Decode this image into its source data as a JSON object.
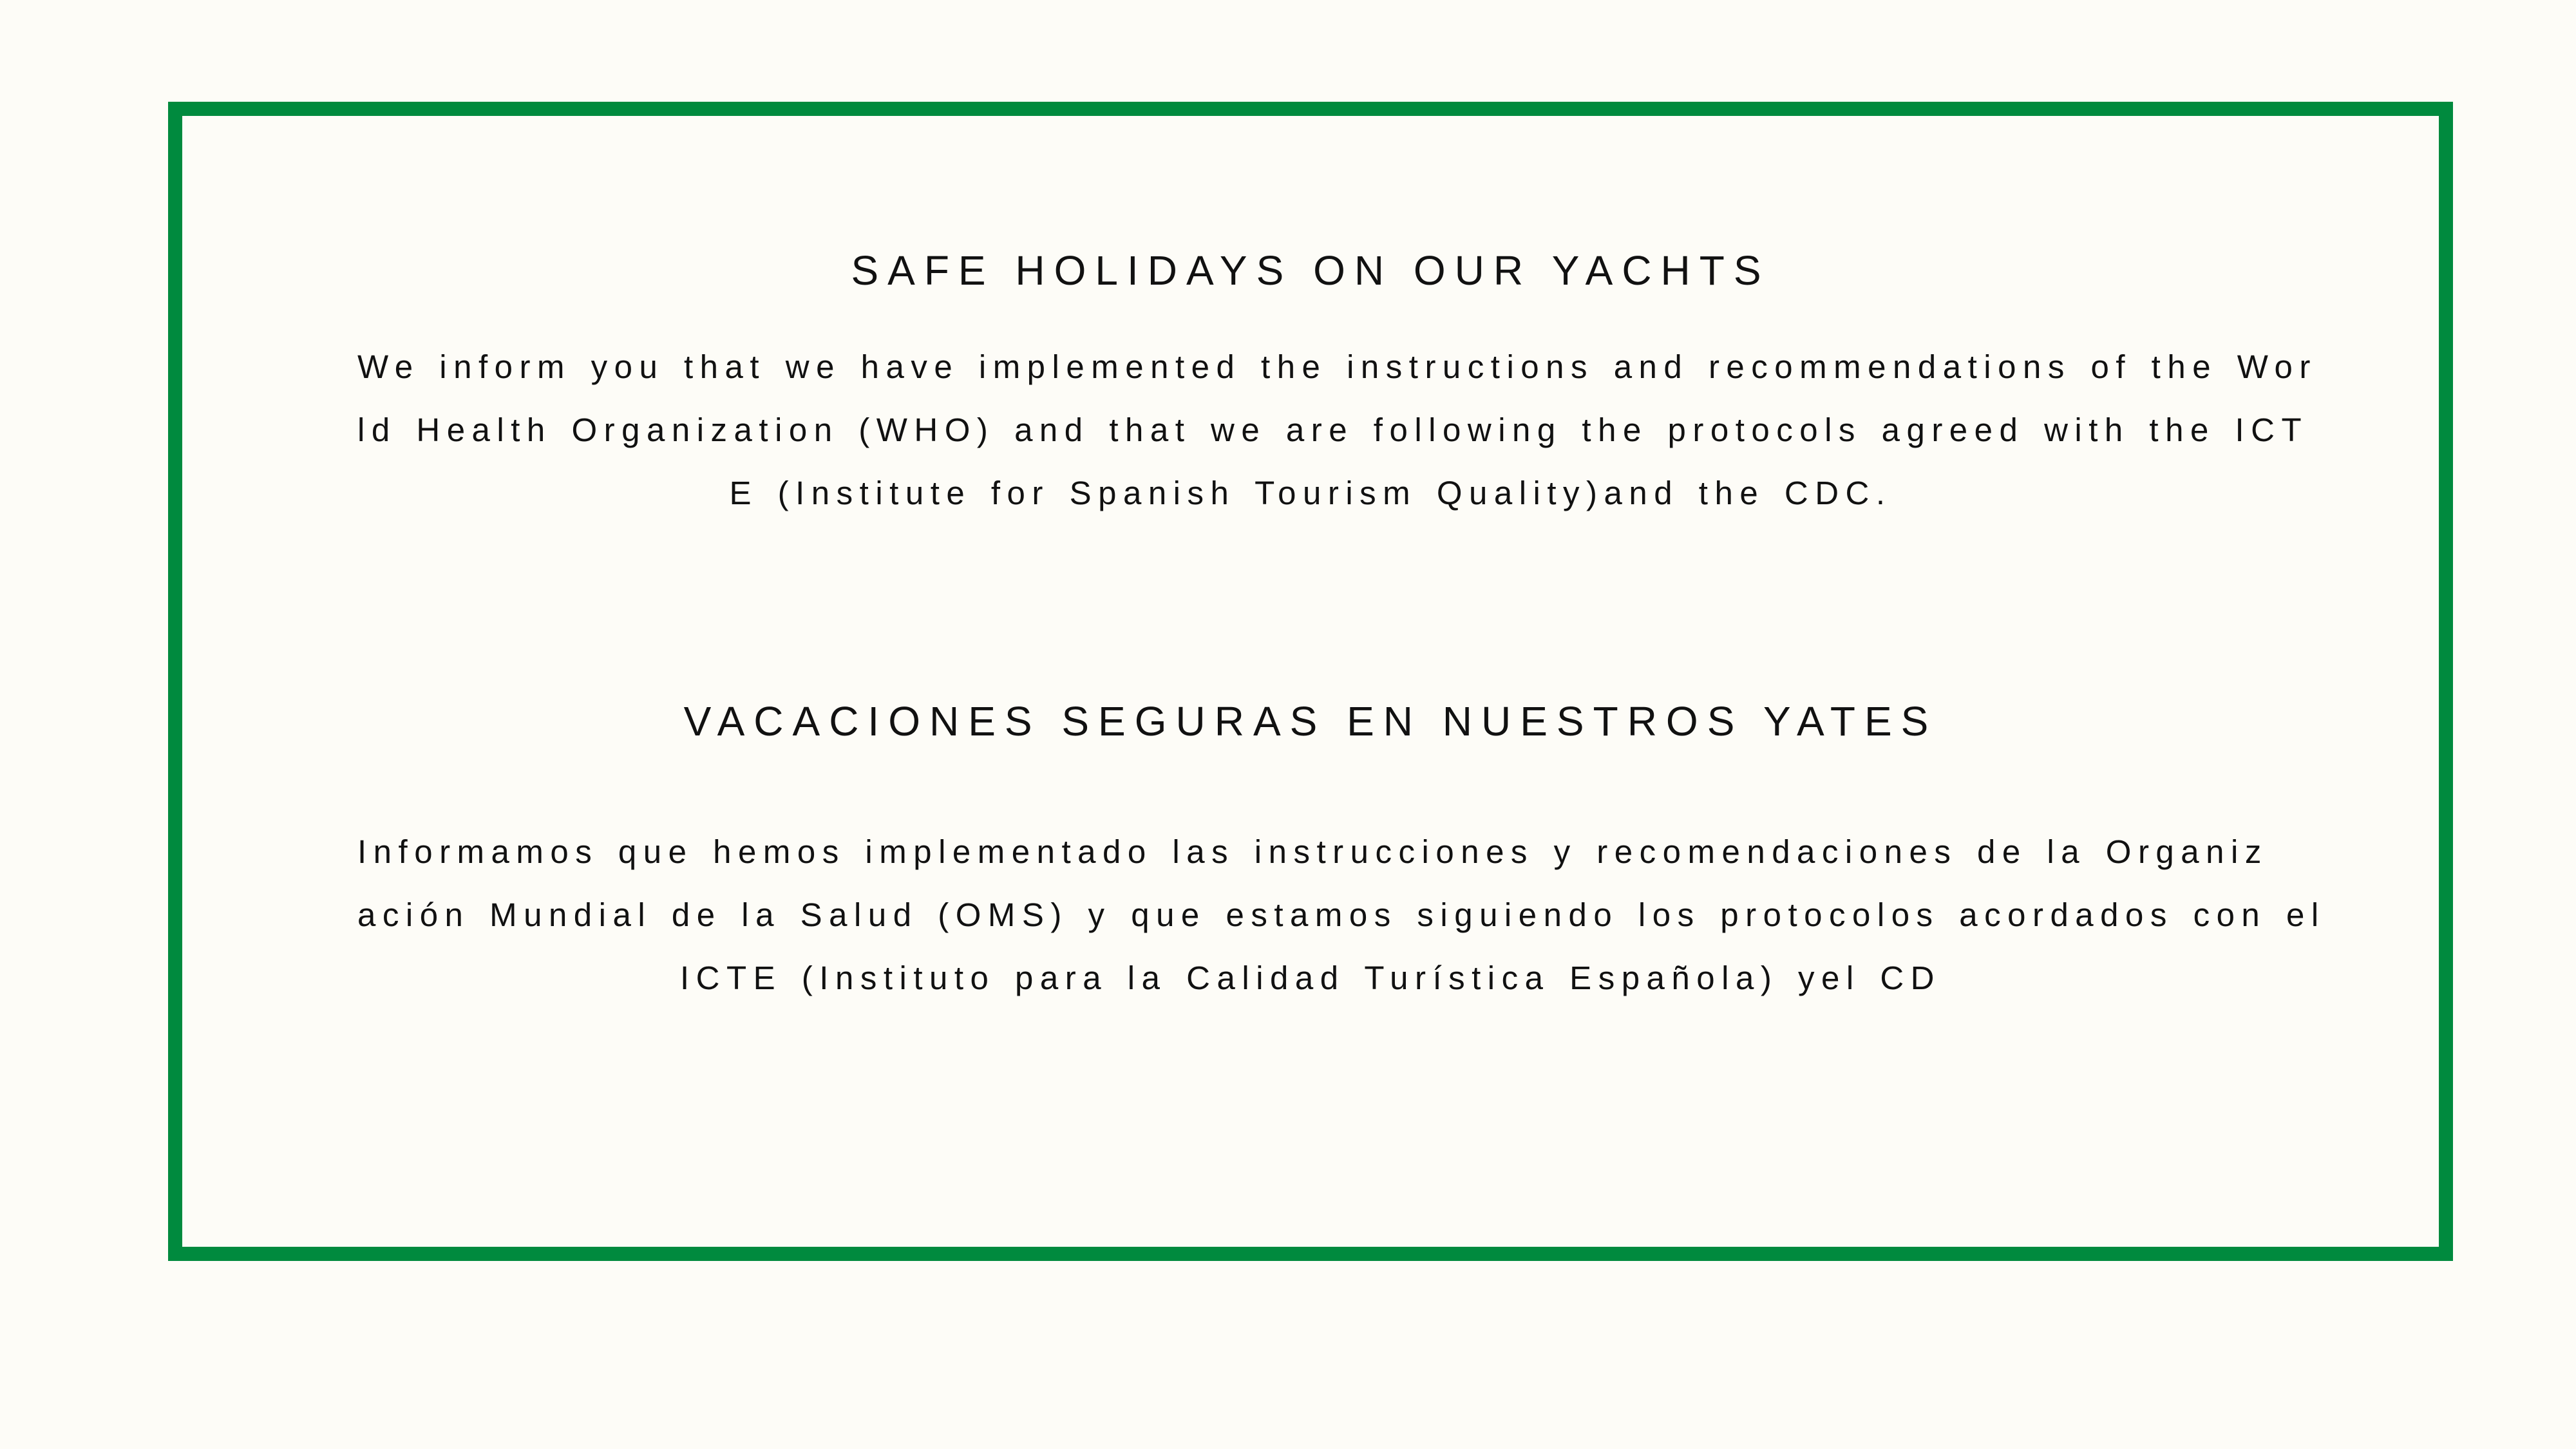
{
  "notice": {
    "english": {
      "title": "SAFE HOLIDAYS ON OUR YACHTS",
      "lines": [
        "We inform you that we have implemented the instructions and recommendations of the Wor",
        "ld Health Organization (WHO) and that we are following the  protocols agreed with the ICT",
        "E (Institute for Spanish Tourism Quality)and the CDC."
      ]
    },
    "spanish": {
      "title": "VACACIONES SEGURAS EN NUESTROS YATES",
      "lines": [
        "Informamos que hemos implementado las instrucciones y recomendaciones de la Organiz",
        "ación Mundial de la Salud (OMS) y que estamos siguiendo los protocolos acordados con el",
        "ICTE (Instituto para la Calidad Turística Española) yel CD"
      ]
    }
  },
  "colors": {
    "frame_border": "#008a3e",
    "background": "#fdfcf7",
    "text": "#111111"
  }
}
